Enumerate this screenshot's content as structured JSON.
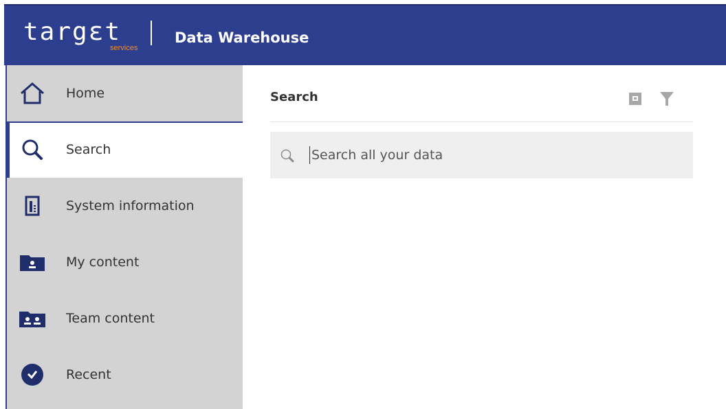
{
  "header": {
    "logo": {
      "main": "targεt",
      "sub": "services"
    },
    "title": "Data Warehouse"
  },
  "sidebar": {
    "items": [
      {
        "label": "Home",
        "icon": "home-icon",
        "active": false
      },
      {
        "label": "Search",
        "icon": "search-icon",
        "active": true
      },
      {
        "label": "System information",
        "icon": "system-information-icon",
        "active": false
      },
      {
        "label": "My content",
        "icon": "my-content-folder-icon",
        "active": false
      },
      {
        "label": "Team content",
        "icon": "team-content-folder-icon",
        "active": false
      },
      {
        "label": "Recent",
        "icon": "recent-check-icon",
        "active": false
      }
    ]
  },
  "main": {
    "title": "Search",
    "toolbar": {
      "icons": [
        "saved-search-icon",
        "filter-icon"
      ]
    },
    "search": {
      "placeholder": "Search all your data",
      "value": ""
    }
  },
  "colors": {
    "brand": "#2d3e8e",
    "logo_accent": "#f28c28",
    "sidebar_bg": "#d3d3d3",
    "search_bg": "#efefef",
    "icon_disabled": "#a6a6a6"
  }
}
